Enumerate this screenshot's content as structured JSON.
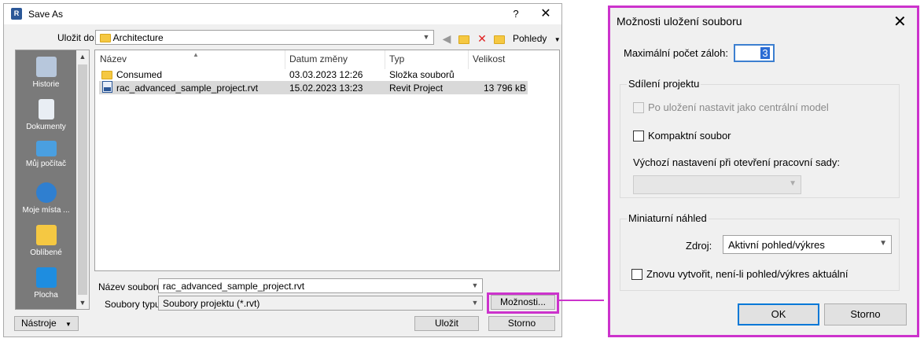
{
  "save_as": {
    "title": "Save As",
    "help_glyph": "?",
    "close_glyph": "✕",
    "save_in_label": "Uložit do:",
    "save_in_value": "Architecture",
    "views_label": "Pohledy",
    "places": [
      {
        "label": "Historie"
      },
      {
        "label": "Dokumenty"
      },
      {
        "label": "Můj počítač"
      },
      {
        "label": "Moje místa ..."
      },
      {
        "label": "Oblíbené"
      },
      {
        "label": "Plocha"
      }
    ],
    "columns": {
      "name": "Název",
      "date": "Datum změny",
      "type": "Typ",
      "size": "Velikost"
    },
    "files": [
      {
        "name": "Consumed",
        "date": "03.03.2023 12:26",
        "type": "Složka souborů",
        "size": ""
      },
      {
        "name": "rac_advanced_sample_project.rvt",
        "date": "15.02.2023 13:23",
        "type": "Revit Project",
        "size": "13 796 kB"
      }
    ],
    "filename_label": "Název souboru:",
    "filename_value": "rac_advanced_sample_project.rvt",
    "filetype_label": "Soubory typu:",
    "filetype_value": "Soubory projektu  (*.rvt)",
    "options_button": "Možnosti...",
    "tools_button": "Nástroje",
    "save_button": "Uložit",
    "cancel_button": "Storno"
  },
  "options_dialog": {
    "title": "Možnosti uložení souboru",
    "close_glyph": "✕",
    "max_backups_label": "Maximální počet záloh:",
    "max_backups_value": "3",
    "sharing_group": "Sdílení projektu",
    "make_central_label": "Po uložení nastavit jako centrální model",
    "compact_label": "Kompaktní soubor",
    "default_open_label": "Výchozí nastavení při otevření pracovní sady:",
    "default_open_value": "",
    "thumbnail_group": "Miniaturní náhled",
    "source_label": "Zdroj:",
    "source_value": "Aktivní pohled/výkres",
    "regenerate_label": "Znovu vytvořit, není-li pohled/výkres aktuální",
    "ok_button": "OK",
    "cancel_button": "Storno"
  },
  "colors": {
    "highlight": "#cc33cc",
    "selection": "#d9d9d9",
    "accent": "#0078d7"
  }
}
